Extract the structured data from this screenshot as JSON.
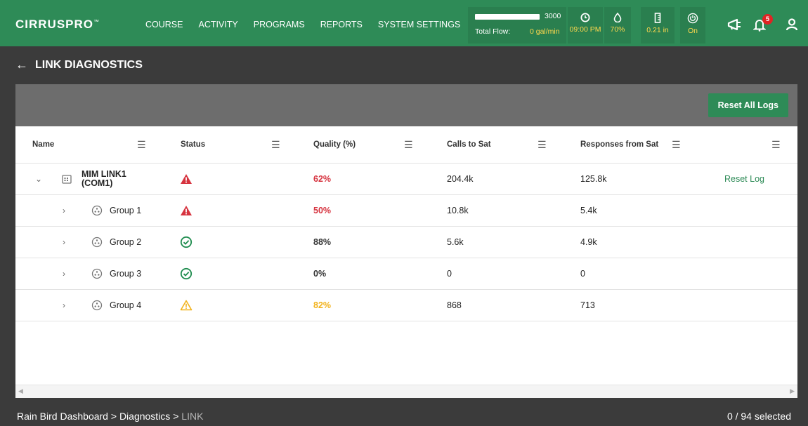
{
  "app": {
    "logo_main": "CIRRUS",
    "logo_bold": "PRO",
    "logo_tm": "™"
  },
  "nav": {
    "items": [
      "COURSE",
      "ACTIVITY",
      "PROGRAMS",
      "REPORTS",
      "SYSTEM SETTINGS"
    ]
  },
  "flow": {
    "max": "3000",
    "label": "Total Flow:",
    "value": "0 gal/min",
    "level_fraction": 1.0
  },
  "stats": {
    "time": "09:00 PM",
    "humidity": "70%",
    "rain": "0.21 in",
    "power": "On"
  },
  "notifications": {
    "count": "5"
  },
  "page": {
    "title": "LINK DIAGNOSTICS",
    "reset_all_label": "Reset All Logs"
  },
  "table": {
    "headers": {
      "name": "Name",
      "status": "Status",
      "quality": "Quality (%)",
      "calls": "Calls to Sat",
      "responses": "Responses from Sat"
    },
    "parent": {
      "name_line1": "MIM LINK1",
      "name_line2": "(COM1)",
      "status": "error",
      "quality": "62%",
      "calls": "204.4k",
      "responses": "125.8k",
      "reset_label": "Reset Log"
    },
    "groups": [
      {
        "name": "Group 1",
        "status": "error",
        "quality": "50%",
        "calls": "10.8k",
        "responses": "5.4k"
      },
      {
        "name": "Group 2",
        "status": "ok",
        "quality": "88%",
        "calls": "5.6k",
        "responses": "4.9k"
      },
      {
        "name": "Group 3",
        "status": "ok",
        "quality": "0%",
        "calls": "0",
        "responses": "0"
      },
      {
        "name": "Group 4",
        "status": "warning",
        "quality": "82%",
        "calls": "868",
        "responses": "713"
      }
    ]
  },
  "footer": {
    "crumb1": "Rain Bird Dashboard",
    "crumb2": "Diagnostics",
    "crumb3": "LINK",
    "sep": ">",
    "selection": "0 / 94 selected"
  },
  "colors": {
    "brand_green": "#2e8b57",
    "error_red": "#d6333f",
    "ok_green": "#1e8c4e",
    "warning_amber": "#f2b21b",
    "stat_yellow": "#ffd84d"
  }
}
